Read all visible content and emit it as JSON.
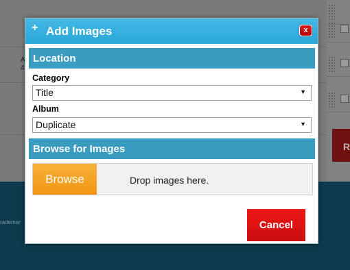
{
  "background": {
    "left_snippet_line1": "A",
    "left_snippet_line2": "4",
    "footer_text": "rademar",
    "red_button_fragment": "R"
  },
  "dialog": {
    "title_icon": "+",
    "title": "Add Images",
    "close_label": "x",
    "location_section": "Location",
    "category_label": "Category",
    "category_value": "Title",
    "album_label": "Album",
    "album_value": "Duplicate",
    "browse_section": "Browse for Images",
    "browse_button": "Browse",
    "drop_text": "Drop images here.",
    "cancel_button": "Cancel",
    "dropdown_arrow": "▼"
  },
  "colors": {
    "title_bar": "#2aa6d8",
    "section_bar": "#3a9cc1",
    "browse_button": "#f19512",
    "cancel_button": "#e01010"
  }
}
